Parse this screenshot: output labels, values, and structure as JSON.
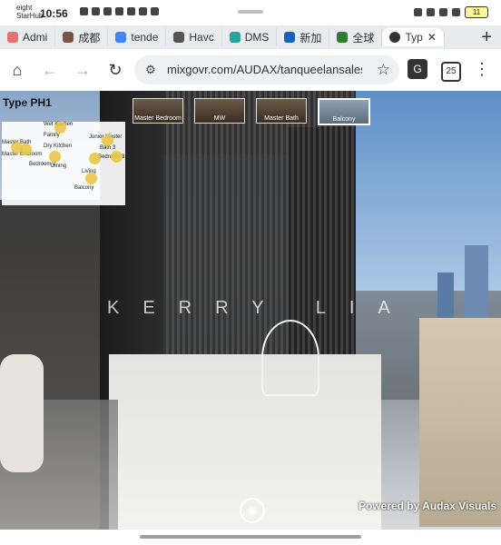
{
  "status": {
    "carrier_line1": "eight",
    "carrier_line2": "StarHub",
    "time": "10:56",
    "battery": "11"
  },
  "tabs": [
    {
      "label": "Admi",
      "favicon_color": "#e57373"
    },
    {
      "label": "成都",
      "favicon_color": "#795548"
    },
    {
      "label": "tende",
      "favicon_color": "#4285f4"
    },
    {
      "label": "Havc",
      "favicon_color": "#555555"
    },
    {
      "label": "DMS",
      "favicon_color": "#26a69a"
    },
    {
      "label": "新加",
      "favicon_color": "#1565c0"
    },
    {
      "label": "全球",
      "favicon_color": "#2e7d32"
    },
    {
      "label": "Typ",
      "favicon_color": "#333333"
    }
  ],
  "address": {
    "url": "mixgovr.com/AUDAX/tanqueelansalesk",
    "tab_count": "25"
  },
  "viewer": {
    "plan_title": "Type PH1",
    "rooms": [
      "Master Bedroom",
      "Master Bath",
      "Wet Kitchen",
      "Family",
      "Dry Kitchen",
      "Dining",
      "Living",
      "Balcony",
      "Junior Master",
      "Bath 3",
      "Bedroom 3",
      "Bedroom 2"
    ],
    "thumbnails": [
      "Master Bedroom",
      "MW",
      "Master Bath",
      "Balcony"
    ],
    "watermark": "KERRY LIA",
    "powered_by": "Powered by Audax Visuals"
  }
}
